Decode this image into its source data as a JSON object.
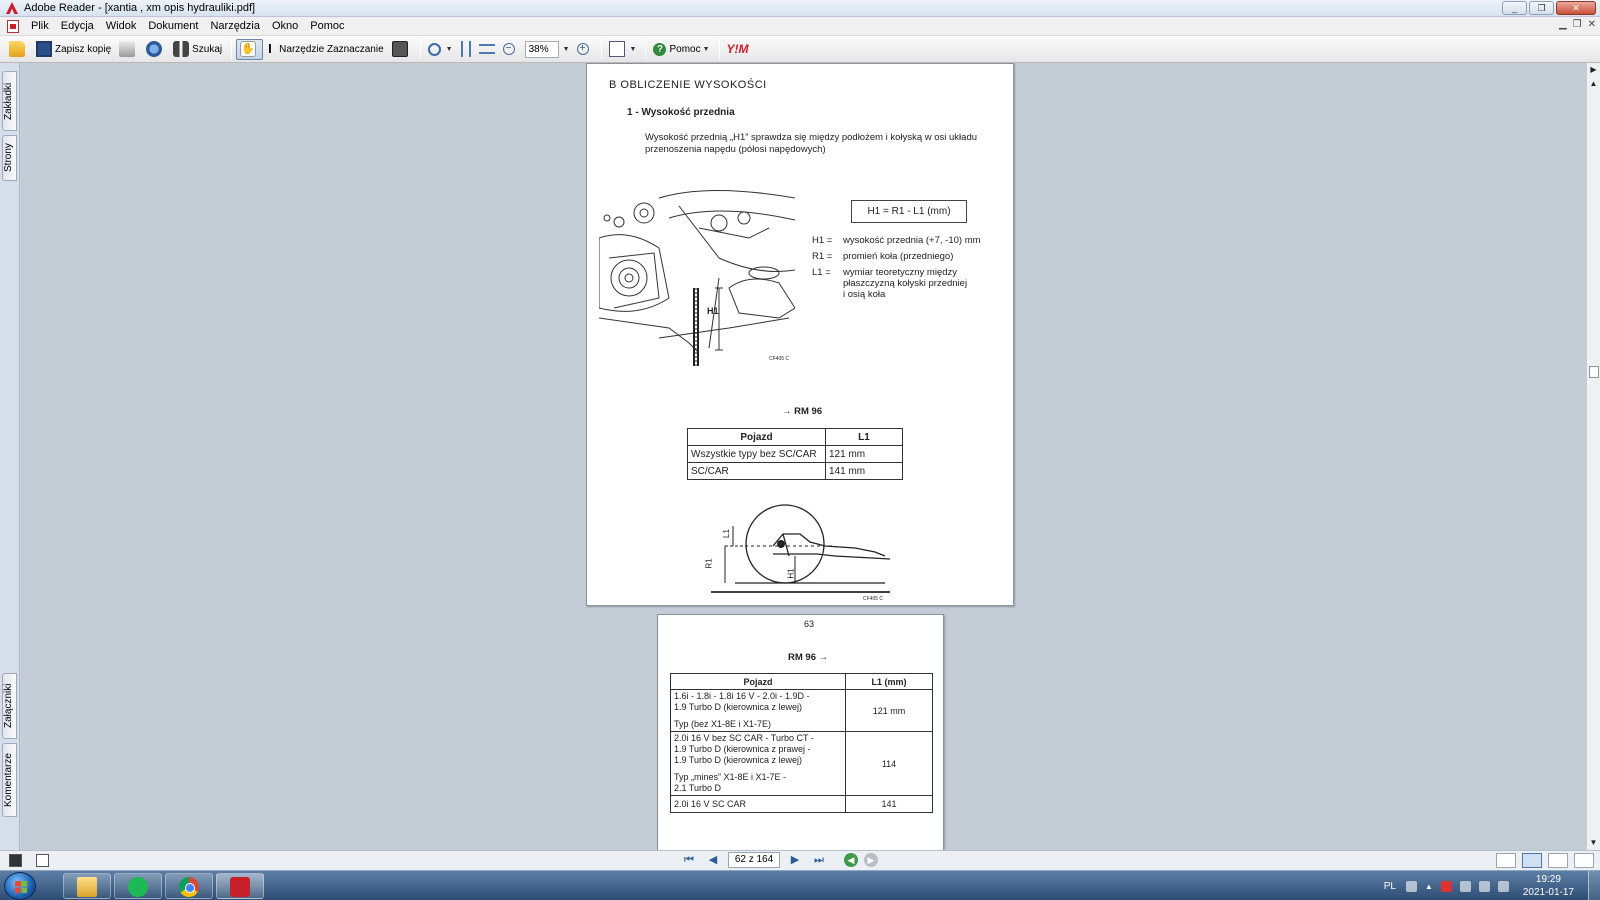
{
  "window": {
    "title": "Adobe Reader - [xantia , xm opis hydrauliki.pdf]",
    "buttons": [
      "_",
      "❐",
      "✕"
    ]
  },
  "menu": [
    "Plik",
    "Edycja",
    "Widok",
    "Dokument",
    "Narzędzia",
    "Okno",
    "Pomoc"
  ],
  "toolbar": {
    "save_copy": "Zapisz kopię",
    "search": "Szukaj",
    "select_tool": "Narzędzie Zaznaczanie",
    "zoom_value": "38%",
    "help": "Pomoc",
    "ym_label": "Y!M"
  },
  "left_tabs": {
    "bookmarks": "Zakładki",
    "pages": "Strony",
    "attachments": "Załączniki",
    "comments": "Komentarze"
  },
  "page1": {
    "section": "B    OBLICZENIE WYSOKOŚCI",
    "subsection": "1 -   Wysokość przednia",
    "para_line1": "Wysokość przednią „H1” sprawdza się między podłożem i kołyską w osi układu",
    "para_line2": "przenoszenia napędu (półosi napędowych)",
    "formula": "H1 = R1 - L1 (mm)",
    "defs": [
      {
        "sym": "H1  =",
        "text": "wysokość przednia (+7, -10) mm"
      },
      {
        "sym": "R1  =",
        "text": "promień koła (przedniego)"
      },
      {
        "sym": "L1  =",
        "text": "wymiar teoretyczny między"
      }
    ],
    "def_cont1": "płaszczyzną kołyski przedniej",
    "def_cont2": "i osią koła",
    "fig_label_h1": "H1",
    "fig_code": "CF405 C",
    "arrow_label": "→ RM 96",
    "table_headers": [
      "Pojazd",
      "L1"
    ],
    "table_rows": [
      [
        "Wszystkie typy bez SC/CAR",
        "121 mm"
      ],
      [
        "SC/CAR",
        "141 mm"
      ]
    ],
    "diagram_labels": {
      "l1": "L1",
      "r1": "R1",
      "h1": "H1",
      "code": "CF405 C"
    }
  },
  "page2": {
    "page_number": "63",
    "heading": "RM 96  →",
    "table_headers": [
      "Pojazd",
      "L1 (mm)"
    ],
    "rows": [
      {
        "a": "1.6i - 1.8i - 1.8i 16 V - 2.0i - 1.9D -",
        "b": "1.9 Turbo D (kierownica z lewej)",
        "c": "Typ (bez X1-8E i X1-7E)",
        "val": "121 mm"
      },
      {
        "a": "2.0i 16 V bez SC CAR - Turbo CT -",
        "b": "1.9 Turbo D (kierownica z prawej -",
        "c": "1.9 Turbo D (kierownica z lewej)",
        "d": "Typ „mines” X1-8E i X1-7E -",
        "e": "2.1 Turbo D",
        "val": "114"
      },
      {
        "a": "2.0i 16 V SC CAR",
        "val": "141"
      }
    ]
  },
  "nav": {
    "page_indicator": "62 z 164"
  },
  "taskbar": {
    "lang": "PL",
    "time": "19:29",
    "date": "2021-01-17"
  }
}
